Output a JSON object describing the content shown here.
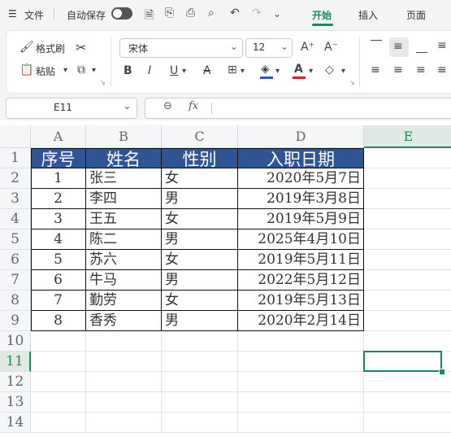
{
  "menubar": {
    "menu_icon": "☰",
    "file": "文件",
    "autosave": "自动保存",
    "tabs": [
      "开始",
      "插入",
      "页面"
    ]
  },
  "ribbon": {
    "format_painter": "格式刷",
    "paste": "粘贴",
    "font_name": "宋体",
    "font_size": "12"
  },
  "formula_bar": {
    "name_box": "E11",
    "fx": "fx",
    "value": ""
  },
  "columns": [
    "A",
    "B",
    "C",
    "D",
    "E"
  ],
  "rows": [
    "1",
    "2",
    "3",
    "4",
    "5",
    "6",
    "7",
    "8",
    "9",
    "10",
    "11",
    "12",
    "13",
    "14"
  ],
  "table": {
    "header": [
      "序号",
      "姓名",
      "性别",
      "入职日期"
    ],
    "rows": [
      [
        "1",
        "张三",
        "女",
        "2020年5月7日"
      ],
      [
        "2",
        "李四",
        "男",
        "2019年3月8日"
      ],
      [
        "3",
        "王五",
        "女",
        "2019年5月9日"
      ],
      [
        "4",
        "陈二",
        "男",
        "2025年4月10日"
      ],
      [
        "5",
        "苏六",
        "女",
        "2019年5月11日"
      ],
      [
        "6",
        "牛马",
        "男",
        "2022年5月12日"
      ],
      [
        "7",
        "勤劳",
        "女",
        "2019年5月13日"
      ],
      [
        "8",
        "香秀",
        "男",
        "2020年2月14日"
      ]
    ]
  },
  "colors": {
    "header_fill": "#2f5597",
    "accent": "#1a8a5a",
    "selected_column": "#e9f1ec"
  }
}
